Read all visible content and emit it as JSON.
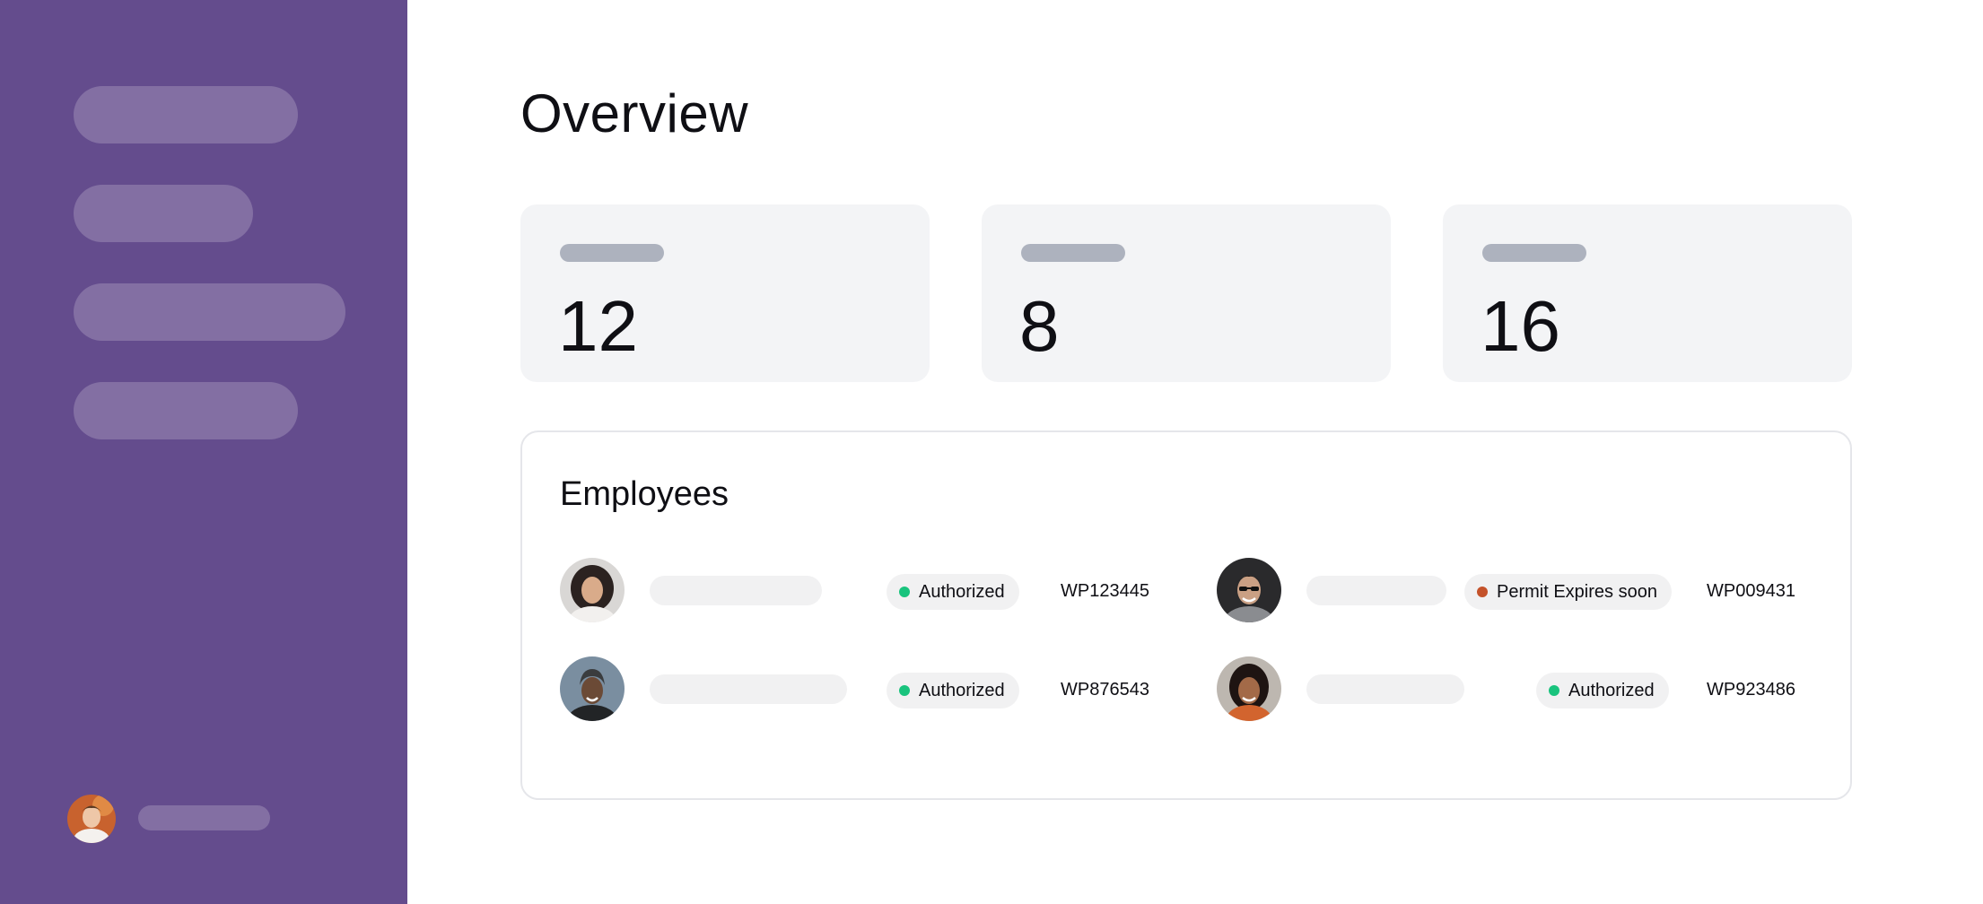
{
  "colors": {
    "sidebar_bg": "#644c8d",
    "status_authorized": "#19c37d",
    "status_warning": "#c4522a"
  },
  "main": {
    "title": "Overview",
    "stats": [
      {
        "value": "12"
      },
      {
        "value": "8"
      },
      {
        "value": "16"
      }
    ],
    "employees": {
      "title": "Employees",
      "rows": [
        {
          "status": "Authorized",
          "status_color": "#19c37d",
          "permit_id": "WP123445"
        },
        {
          "status": "Permit Expires soon",
          "status_color": "#c4522a",
          "permit_id": "WP009431"
        },
        {
          "status": "Authorized",
          "status_color": "#19c37d",
          "permit_id": "WP876543"
        },
        {
          "status": "Authorized",
          "status_color": "#19c37d",
          "permit_id": "WP923486"
        }
      ]
    }
  }
}
